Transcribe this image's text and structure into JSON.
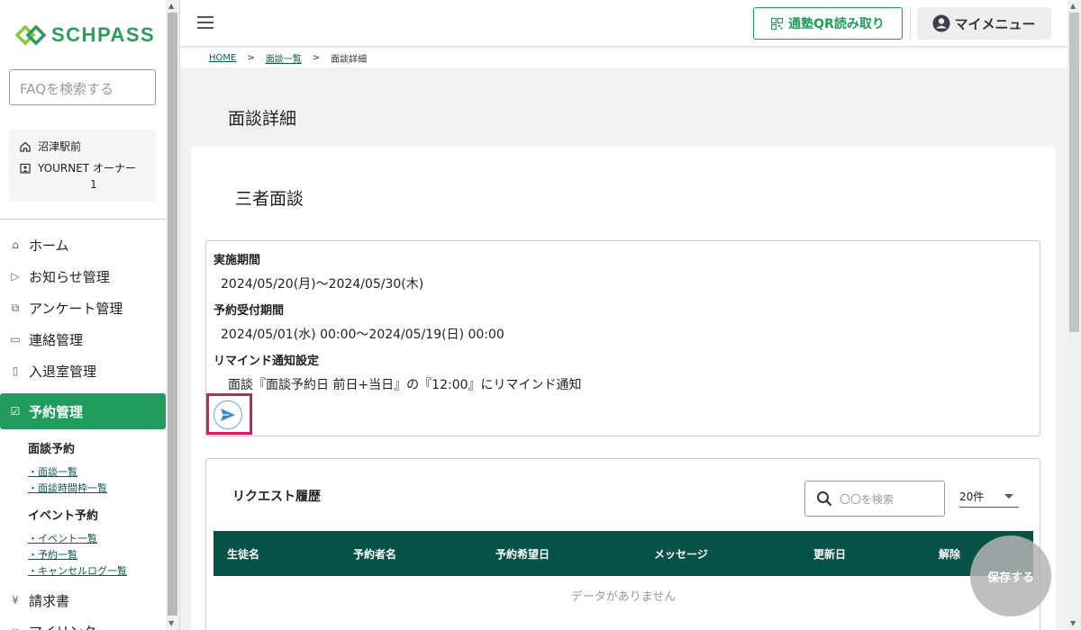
{
  "brand": {
    "name": "SCHPASS",
    "accent": "#209c5d",
    "dark": "#075247"
  },
  "sidebar": {
    "faq_placeholder": "FAQを検索する",
    "school_name": "沼津駅前",
    "user_name": "YOURNET オーナー",
    "user_id": "1",
    "menu": [
      {
        "label": "ホーム",
        "icon": "home-icon"
      },
      {
        "label": "お知らせ管理",
        "icon": "send-icon"
      },
      {
        "label": "アンケート管理",
        "icon": "survey-icon"
      },
      {
        "label": "連絡管理",
        "icon": "chat-icon"
      },
      {
        "label": "入退室管理",
        "icon": "door-icon"
      },
      {
        "label": "予約管理",
        "icon": "calendar-check-icon"
      }
    ],
    "reservation_sub": {
      "interview_head": "面談予約",
      "interview_links": [
        "・面談一覧",
        "・面談時間枠一覧"
      ],
      "event_head": "イベント予約",
      "event_links": [
        "・イベント一覧",
        "・予約一覧",
        "・キャンセルログ一覧"
      ]
    },
    "menu_after": [
      {
        "label": "請求書",
        "icon": "yen-icon"
      },
      {
        "label": "マイリンク",
        "icon": "link-icon"
      }
    ]
  },
  "header": {
    "qr_label": "通塾QR読み取り",
    "mymenu_label": "マイメニュー"
  },
  "breadcrumb": {
    "home": "HOME",
    "list": "面談一覧",
    "current": "面談詳細",
    "sep": ">"
  },
  "page_title": "面談詳細",
  "interview": {
    "title": "三者面談",
    "period_label": "実施期間",
    "period_value": "2024/05/20(月)～2024/05/30(木)",
    "accept_label": "予約受付期間",
    "accept_value": "2024/05/01(水) 00:00～2024/05/19(日) 00:00",
    "remind_label": "リマインド通知設定",
    "remind_value": "面談『面談予約日 前日+当日』の『12:00』にリマインド通知"
  },
  "requests": {
    "title": "リクエスト履歴",
    "search_placeholder": "〇〇を検索",
    "per_page": "20件",
    "columns": [
      "生徒名",
      "予約者名",
      "予約希望日",
      "メッセージ",
      "更新日",
      "解除"
    ],
    "empty_text": "データがありません"
  },
  "save_label": "保存する"
}
